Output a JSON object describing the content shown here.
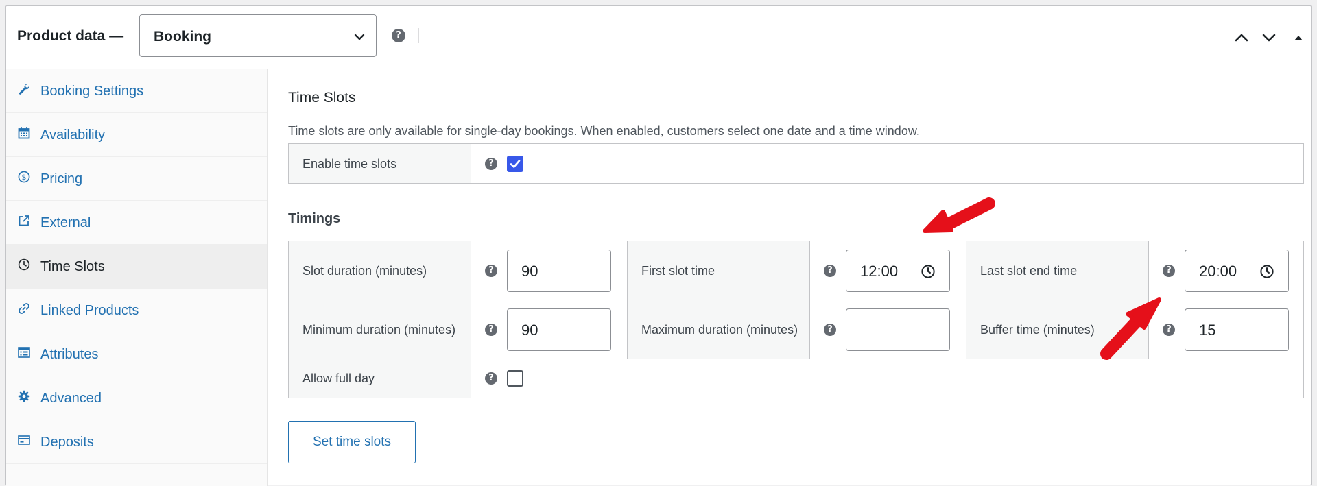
{
  "header": {
    "title": "Product data —",
    "product_type": "Booking",
    "help_icon": "question-circle-icon"
  },
  "sidebar": {
    "items": [
      {
        "label": "Booking Settings",
        "icon": "wrench-icon"
      },
      {
        "label": "Availability",
        "icon": "calendar-icon"
      },
      {
        "label": "Pricing",
        "icon": "dollar-circle-icon"
      },
      {
        "label": "External",
        "icon": "external-link-icon"
      },
      {
        "label": "Time Slots",
        "icon": "clock-icon",
        "active": true
      },
      {
        "label": "Linked Products",
        "icon": "link-icon"
      },
      {
        "label": "Attributes",
        "icon": "list-icon"
      },
      {
        "label": "Advanced",
        "icon": "gear-icon"
      },
      {
        "label": "Deposits",
        "icon": "card-icon"
      }
    ]
  },
  "main": {
    "section_title": "Time Slots",
    "section_desc": "Time slots are only available for single-day bookings. When enabled, customers select one date and a time window.",
    "enable_label": "Enable time slots",
    "enable_checked": true,
    "timings_title": "Timings",
    "slot_duration_label": "Slot duration (minutes)",
    "slot_duration_value": "90",
    "first_slot_label": "First slot time",
    "first_slot_value": "12:00",
    "last_slot_label": "Last slot end time",
    "last_slot_value": "20:00",
    "min_duration_label": "Minimum duration (minutes)",
    "min_duration_value": "90",
    "max_duration_label": "Maximum duration (minutes)",
    "max_duration_value": "",
    "buffer_label": "Buffer time (minutes)",
    "buffer_value": "15",
    "full_day_label": "Allow full day",
    "full_day_checked": false,
    "set_button": "Set time slots"
  },
  "colors": {
    "link": "#2271b1",
    "checkbox": "#3858e9",
    "annotation_arrow": "#e5101a"
  }
}
